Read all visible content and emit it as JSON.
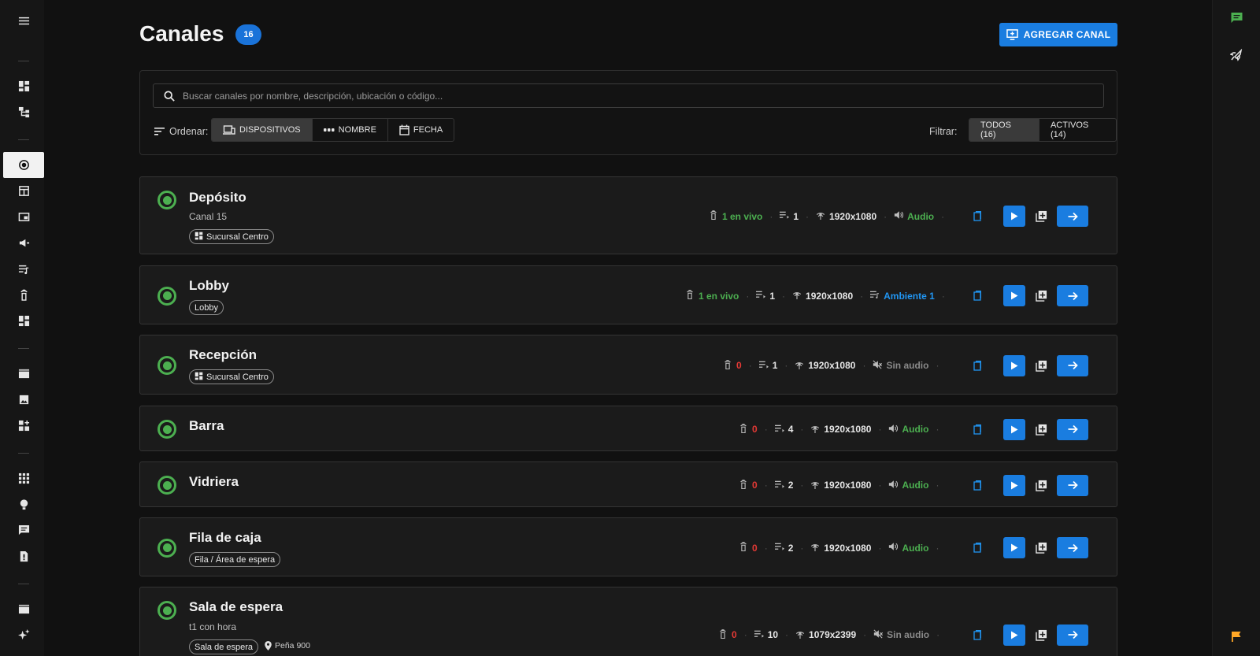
{
  "header": {
    "title": "Canales",
    "count": "16",
    "add_label": "AGREGAR CANAL"
  },
  "search": {
    "placeholder": "Buscar canales por nombre, descripción, ubicación o código..."
  },
  "sort": {
    "label": "Ordenar:",
    "options": [
      "DISPOSITIVOS",
      "NOMBRE",
      "FECHA"
    ],
    "selected": "DISPOSITIVOS"
  },
  "filter": {
    "label": "Filtrar:",
    "options": [
      "TODOS (16)",
      "ACTIVOS (14)"
    ],
    "selected": "TODOS (16)"
  },
  "colors": {
    "accent": "#1a7de0",
    "active": "#4caf50",
    "inactive": "#e53935",
    "link": "#2196f3"
  },
  "channels": [
    {
      "name": "Depósito",
      "desc": "Canal 15",
      "chip": "Sucursal Centro",
      "chip_icon": "dashboard-icon",
      "live": "1 en vivo",
      "live_color": "green",
      "queue": "1",
      "res": "1920x1080",
      "audio": "Audio",
      "audio_color": "green",
      "audio_icon": "volume-icon"
    },
    {
      "name": "Lobby",
      "desc": "",
      "chip": "Lobby",
      "chip_icon": "",
      "live": "1 en vivo",
      "live_color": "green",
      "queue": "1",
      "res": "1920x1080",
      "audio": "Ambiente 1",
      "audio_color": "blue",
      "audio_icon": "playlist-icon"
    },
    {
      "name": "Recepción",
      "desc": "",
      "chip": "Sucursal Centro",
      "chip_icon": "dashboard-icon",
      "live": "0",
      "live_color": "red",
      "queue": "1",
      "res": "1920x1080",
      "audio": "Sin audio",
      "audio_color": "grey",
      "audio_icon": "volume-off-icon"
    },
    {
      "name": "Barra",
      "desc": "",
      "chip": "",
      "live": "0",
      "live_color": "red",
      "queue": "4",
      "res": "1920x1080",
      "audio": "Audio",
      "audio_color": "green",
      "audio_icon": "volume-icon"
    },
    {
      "name": "Vidriera",
      "desc": "",
      "chip": "",
      "live": "0",
      "live_color": "red",
      "queue": "2",
      "res": "1920x1080",
      "audio": "Audio",
      "audio_color": "green",
      "audio_icon": "volume-icon"
    },
    {
      "name": "Fila de caja",
      "desc": "",
      "chip": "Fila / Área de espera",
      "chip_icon": "",
      "live": "0",
      "live_color": "red",
      "queue": "2",
      "res": "1920x1080",
      "audio": "Audio",
      "audio_color": "green",
      "audio_icon": "volume-icon"
    },
    {
      "name": "Sala de espera",
      "desc": "t1 con hora",
      "chip": "Sala de espera",
      "chip_icon": "",
      "location": "Peña 900",
      "live": "0",
      "live_color": "red",
      "queue": "10",
      "res": "1079x2399",
      "audio": "Sin audio",
      "audio_color": "grey",
      "audio_icon": "volume-off-icon"
    }
  ],
  "sidebar_icons": [
    "menu-icon",
    "dashboard-icon",
    "hierarchy-icon",
    "channels-icon",
    "layout-icon",
    "screen-icon",
    "campaign-icon",
    "playlist-icon",
    "device-icon",
    "widgets-icon",
    "clapperboard-icon",
    "image-icon",
    "add-widget-icon",
    "apps-icon",
    "lightbulb-icon",
    "message-icon",
    "document-icon",
    "clapperboard-icon",
    "sparkles-icon"
  ],
  "rail_icons": [
    "chat-icon",
    "rocket-icon",
    "flag-icon"
  ]
}
